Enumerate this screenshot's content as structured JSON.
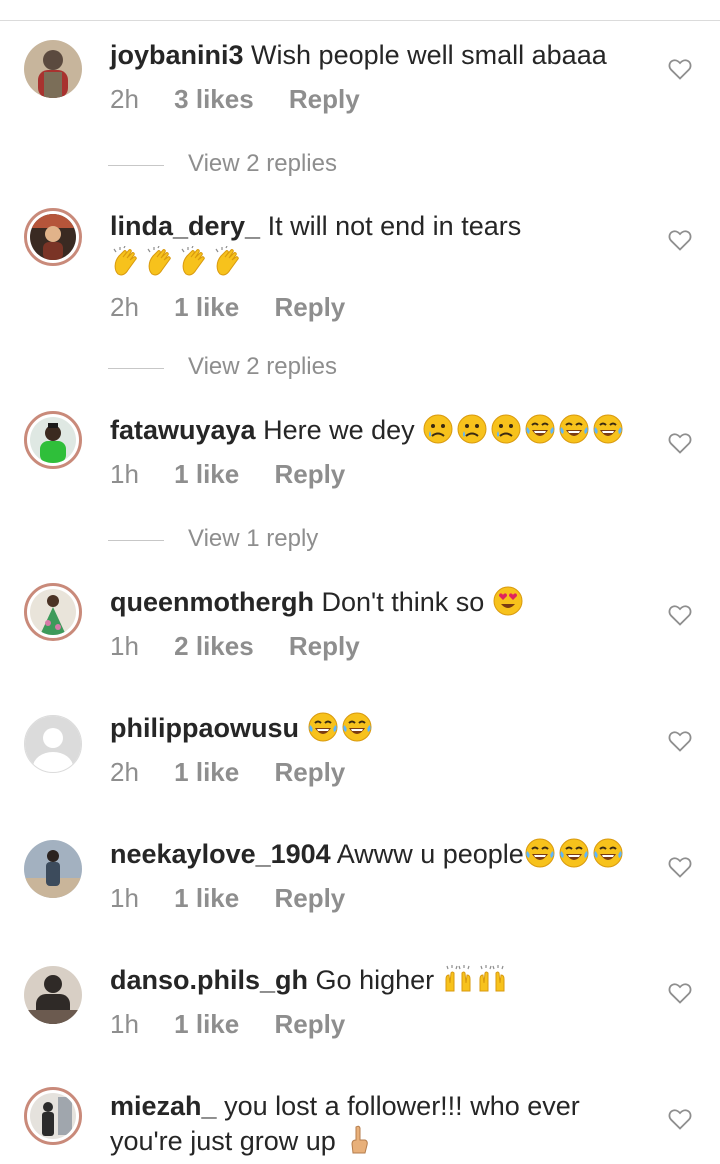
{
  "comments": [
    {
      "username": "joybanini3",
      "text": "Wish people well small abaaa",
      "time": "2h",
      "likes": "3 likes",
      "reply": "Reply",
      "view_replies": "View 2 replies",
      "avatar_colors": [
        "#5b4a3f",
        "#a8322f",
        "#d9c3a5"
      ]
    },
    {
      "username": "linda_dery_",
      "text": "It will not end in tears",
      "emoji_line": [
        "clapping-hands",
        "clapping-hands",
        "clapping-hands",
        "clapping-hands"
      ],
      "time": "2h",
      "likes": "1 like",
      "reply": "Reply",
      "view_replies": "View 2 replies",
      "avatar_colors": [
        "#3a2a22",
        "#b5553a",
        "#e1b38a"
      ]
    },
    {
      "username": "fatawuyaya",
      "text": "Here we dey",
      "emojis": [
        "sad-face",
        "sad-face",
        "sad-face",
        "tears-of-joy",
        "tears-of-joy",
        "tears-of-joy"
      ],
      "time": "1h",
      "likes": "1 like",
      "reply": "Reply",
      "view_replies": "View 1 reply",
      "avatar_colors": [
        "#2fbf3a",
        "#1a1a1a",
        "#dfe8e3"
      ]
    },
    {
      "username": "queenmothergh",
      "text": "Don't think so",
      "emojis": [
        "heart-eyes"
      ],
      "time": "1h",
      "likes": "2 likes",
      "reply": "Reply",
      "avatar_colors": [
        "#3d9a5a",
        "#d77aa8",
        "#e9e4da"
      ]
    },
    {
      "username": "philippaowusu",
      "text": "",
      "emojis": [
        "tears-of-joy",
        "tears-of-joy"
      ],
      "time": "2h",
      "likes": "1 like",
      "reply": "Reply",
      "avatar_colors": [
        "#dbdbdb"
      ]
    },
    {
      "username": "neekaylove_1904",
      "text": "Awww u people",
      "emojis": [
        "tears-of-joy",
        "tears-of-joy",
        "tears-of-joy"
      ],
      "time": "1h",
      "likes": "1 like",
      "reply": "Reply",
      "avatar_colors": [
        "#3c4b5c",
        "#a3b1c0",
        "#c9b59a"
      ]
    },
    {
      "username": "danso.phils_gh",
      "text": "Go higher",
      "emojis": [
        "raising-hands",
        "raising-hands"
      ],
      "time": "1h",
      "likes": "1 like",
      "reply": "Reply",
      "avatar_colors": [
        "#2f2a27",
        "#6b5a4f",
        "#d8cfc5"
      ]
    },
    {
      "username": "miezah_",
      "text": "you lost a follower!!! who ever",
      "text_line2": "you're just grow up",
      "emojis_line2": [
        "index-pointing-up"
      ],
      "avatar_colors": [
        "#2b2b2b",
        "#a0a6ad",
        "#e5e2dd"
      ]
    }
  ],
  "colors": {
    "text": "#262626",
    "meta": "#8e8e8e",
    "ring": "#c98a7a",
    "emoji_yellow": "#f7c21c"
  }
}
